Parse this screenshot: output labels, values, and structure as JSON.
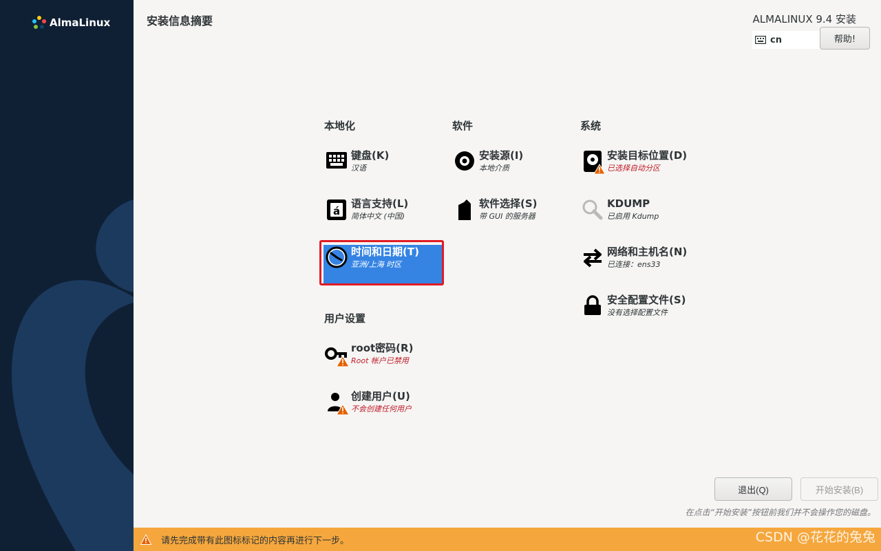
{
  "sidebar": {
    "logo_text": "AlmaLinux"
  },
  "header": {
    "page_title": "安装信息摘要",
    "product_title": "ALMALINUX 9.4 安装",
    "keyboard_layout": "cn",
    "help_label": "帮助!"
  },
  "sections": {
    "localization": "本地化",
    "software": "软件",
    "system": "系统",
    "user_settings": "用户设置"
  },
  "spokes": {
    "keyboard": {
      "name": "键盘(K)",
      "status": "汉语",
      "icon": "keyboard-icon"
    },
    "language": {
      "name": "语言支持(L)",
      "status": "简体中文 (中国)",
      "icon": "language-icon"
    },
    "datetime": {
      "name": "时间和日期(T)",
      "status": "亚洲/上海 时区",
      "icon": "clock-icon",
      "selected": true
    },
    "source": {
      "name": "安装源(I)",
      "status": "本地介质",
      "icon": "disc-icon"
    },
    "software_selection": {
      "name": "软件选择(S)",
      "status": "带 GUI 的服务器",
      "icon": "package-icon"
    },
    "destination": {
      "name": "安装目标位置(D)",
      "status": "已选择自动分区",
      "icon": "harddisk-warning-icon",
      "warning": true
    },
    "kdump": {
      "name": "KDUMP",
      "status": "已启用 Kdump",
      "icon": "magnifier-icon"
    },
    "network": {
      "name": "网络和主机名(N)",
      "status": "已连接：ens33",
      "icon": "network-arrows-icon"
    },
    "security": {
      "name": "安全配置文件(S)",
      "status": "没有选择配置文件",
      "icon": "lock-icon"
    },
    "root": {
      "name": "root密码(R)",
      "status": "Root 帐户已禁用",
      "icon": "key-warning-icon",
      "warning": true
    },
    "user": {
      "name": "创建用户(U)",
      "status": "不会创建任何用户",
      "icon": "user-warning-icon",
      "warning": true
    }
  },
  "footer": {
    "quit_label": "退出(Q)",
    "begin_label": "开始安装(B)",
    "note": "在点击“开始安装”按钮前我们并不会操作您的磁盘。",
    "warning_message": "请先完成带有此图标标记的内容再进行下一步。",
    "watermark": "CSDN @花花的兔兔"
  },
  "colors": {
    "sidebar_bg": "#0f2035",
    "selected_bg": "#3584e4",
    "warning_bar": "#f5a73d",
    "warning_text": "#c01c28",
    "highlight_border": "#e01b24"
  }
}
